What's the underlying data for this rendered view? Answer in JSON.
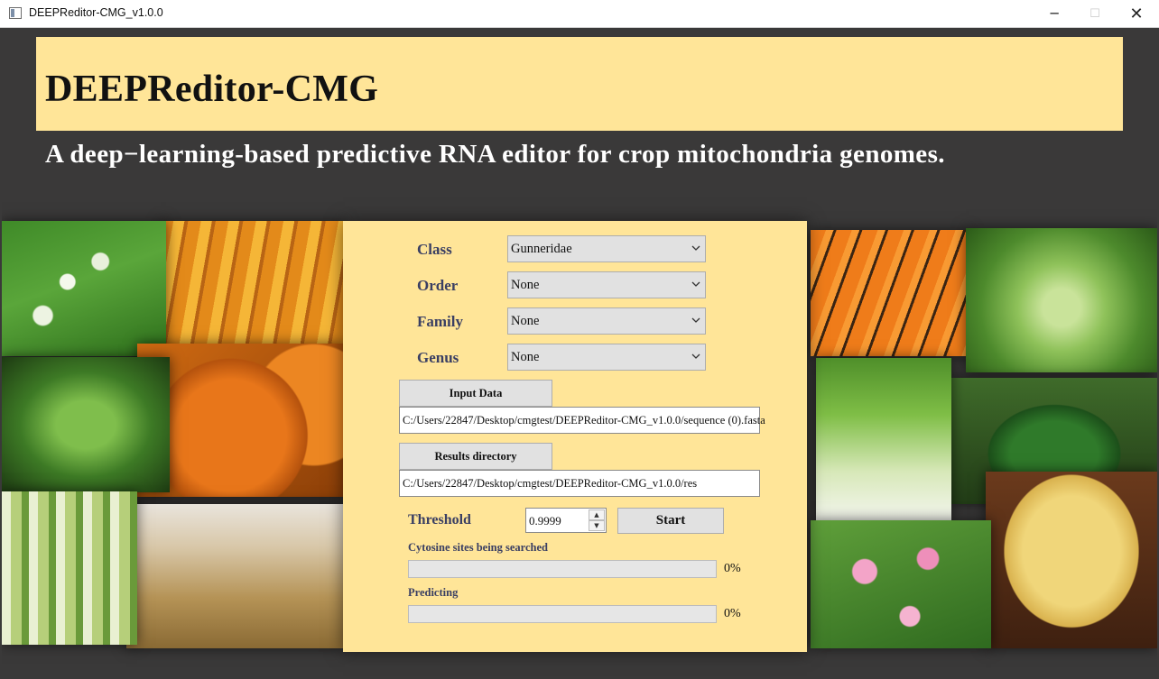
{
  "window": {
    "title": "DEEPReditor-CMG_v1.0.0",
    "minimize_glyph": "─",
    "maximize_glyph": "☐",
    "close_glyph": "✕"
  },
  "banner": {
    "title": "DEEPReditor-CMG"
  },
  "subtitle": "A deep−learning-based predictive RNA editor for crop mitochondria genomes.",
  "form": {
    "class": {
      "label": "Class",
      "value": "Gunneridae"
    },
    "order": {
      "label": "Order",
      "value": "None"
    },
    "family": {
      "label": "Family",
      "value": "None"
    },
    "genus": {
      "label": "Genus",
      "value": "None"
    },
    "input_data": {
      "button": "Input Data",
      "path": "C:/Users/22847/Desktop/cmgtest/DEEPReditor-CMG_v1.0.0/sequence (0).fasta"
    },
    "results": {
      "button": "Results directory",
      "path": "C:/Users/22847/Desktop/cmgtest/DEEPReditor-CMG_v1.0.0/res"
    },
    "threshold": {
      "label": "Threshold",
      "value": "0.9999",
      "up_glyph": "▲",
      "down_glyph": "▼"
    },
    "start_button": "Start",
    "search_progress": {
      "label": "Cytosine sites being searched",
      "percent_text": "0%",
      "value": 0
    },
    "predict_progress": {
      "label": "Predicting",
      "percent_text": "0%",
      "value": 0
    }
  },
  "images": [
    "shepherds-purse",
    "corn",
    "arabidopsis",
    "pumpkin",
    "bok-choy",
    "wheat",
    "carrot",
    "cabbage",
    "lettuce",
    "watermelon",
    "lotus",
    "potato"
  ],
  "colors": {
    "banner": "#ffe598",
    "panel": "#ffe598",
    "background": "#3a3939",
    "label": "#3a3f63"
  }
}
